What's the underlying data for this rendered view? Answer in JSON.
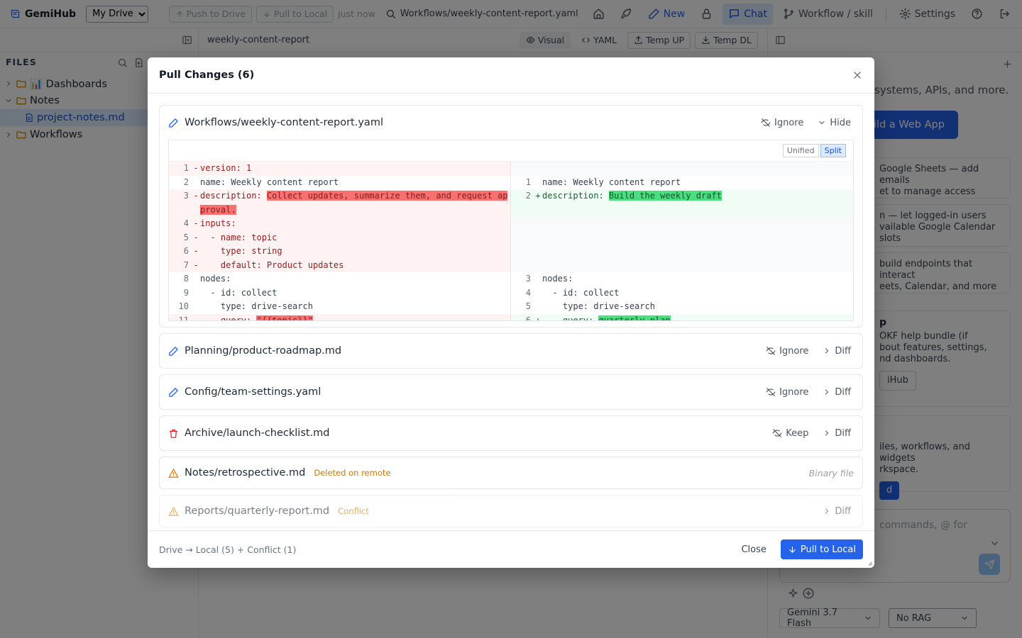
{
  "app": {
    "name": "GemiHub",
    "drive_select": "My Drive"
  },
  "topbar": {
    "push_label": "Push to Drive",
    "pull_label": "Pull to Local",
    "sync_status": "just now",
    "current_path": "Workflows/weekly-content-report.yaml",
    "new_label": "New",
    "chat_label": "Chat",
    "workflow_label": "Workflow / skill",
    "settings_label": "Settings"
  },
  "sidebar": {
    "title": "FILES",
    "items": [
      {
        "label": "📊 Dashboards",
        "type": "folder",
        "expanded": false
      },
      {
        "label": "Notes",
        "type": "folder",
        "expanded": true
      },
      {
        "label": "project-notes.md",
        "type": "file",
        "selected": true
      },
      {
        "label": "Workflows",
        "type": "folder",
        "expanded": false
      }
    ]
  },
  "editor": {
    "filename": "weekly-content-report",
    "visual_label": "Visual",
    "yaml_label": "YAML",
    "temp_up_label": "Temp UP",
    "temp_dl_label": "Temp DL"
  },
  "right_panel": {
    "line1": "systems, APIs, and more.",
    "web_app_button": "ild a Web App",
    "card1": "Google Sheets — add emails\net to manage access",
    "card2": "n — let logged-in users\nvailable Google Calendar slots",
    "card3": "build endpoints that interact\neets, Calendar, and more",
    "card4_letter": "p",
    "card4": "OKF help bundle (if\nbout features, settings,\nnd dashboards.",
    "card4_btn": "iHub",
    "card5": "iles, workflows, and widgets\nrkspace.",
    "card5_btn": "d",
    "chat_placeholder": "commands, @ for",
    "model": "Gemini 3.7 Flash",
    "rag": "No RAG"
  },
  "modal": {
    "title": "Pull Changes (6)",
    "files": [
      {
        "name": "Workflows/weekly-content-report.yaml",
        "icon": "pencil-icon",
        "action": "Ignore",
        "toggle": "Hide"
      },
      {
        "name": "Planning/product-roadmap.md",
        "icon": "pencil-icon",
        "action": "Ignore",
        "toggle": "Diff"
      },
      {
        "name": "Config/team-settings.yaml",
        "icon": "pencil-icon",
        "action": "Ignore",
        "toggle": "Diff"
      },
      {
        "name": "Archive/launch-checklist.md",
        "icon": "trash-icon",
        "action": "Keep",
        "toggle": "Diff"
      },
      {
        "name": "Notes/retrospective.md",
        "icon": "warning-icon",
        "tag": "Deleted on remote",
        "note": "Binary file"
      },
      {
        "name": "Reports/quarterly-report.md",
        "icon": "warning-icon",
        "tag": "Conflict",
        "toggle": "Diff"
      }
    ],
    "diff_view": {
      "unified_label": "Unified",
      "split_label": "Split",
      "mode": "Split"
    },
    "footer_summary": "Drive → Local (5) + Conflict (1)",
    "close_label": "Close",
    "pull_label": "Pull to Local"
  },
  "diff": {
    "left": [
      {
        "n": "1",
        "m": "-",
        "t": "version: 1",
        "k": "del"
      },
      {
        "n": "2",
        "m": "",
        "t": "name: Weekly content report",
        "k": "ctx"
      },
      {
        "n": "3",
        "m": "-",
        "t": "description: ",
        "h": "Collect updates, summarize them, and request approval.",
        "k": "del",
        "tall": true
      },
      {
        "n": "4",
        "m": "-",
        "t": "inputs:",
        "k": "del"
      },
      {
        "n": "5",
        "m": "-",
        "t": "  - name: topic",
        "k": "del"
      },
      {
        "n": "6",
        "m": "-",
        "t": "    type: string",
        "k": "del"
      },
      {
        "n": "7",
        "m": "-",
        "t": "    default: Product updates",
        "k": "del"
      },
      {
        "n": "8",
        "m": "",
        "t": "nodes:",
        "k": "ctx"
      },
      {
        "n": "9",
        "m": "",
        "t": "  - id: collect",
        "k": "ctx"
      },
      {
        "n": "10",
        "m": "",
        "t": "    type: drive-search",
        "k": "ctx"
      },
      {
        "n": "11",
        "m": "-",
        "t": "    query: ",
        "h": "\"{{topic}}\"",
        "k": "del"
      }
    ],
    "right": [
      {
        "n": "",
        "m": "",
        "t": "",
        "k": "empty"
      },
      {
        "n": "1",
        "m": "",
        "t": "name: Weekly content report",
        "k": "ctx"
      },
      {
        "n": "2",
        "m": "+",
        "t": "description: ",
        "h": "Build the weekly draft",
        "k": "add",
        "tall": true
      },
      {
        "n": "",
        "m": "",
        "t": "",
        "k": "empty"
      },
      {
        "n": "",
        "m": "",
        "t": "",
        "k": "empty"
      },
      {
        "n": "",
        "m": "",
        "t": "",
        "k": "empty"
      },
      {
        "n": "",
        "m": "",
        "t": "",
        "k": "empty"
      },
      {
        "n": "3",
        "m": "",
        "t": "nodes:",
        "k": "ctx"
      },
      {
        "n": "4",
        "m": "",
        "t": "  - id: collect",
        "k": "ctx"
      },
      {
        "n": "5",
        "m": "",
        "t": "    type: drive-search",
        "k": "ctx"
      },
      {
        "n": "6",
        "m": "+",
        "t": "    query: ",
        "h": "quarterly plan",
        "k": "add"
      }
    ]
  }
}
